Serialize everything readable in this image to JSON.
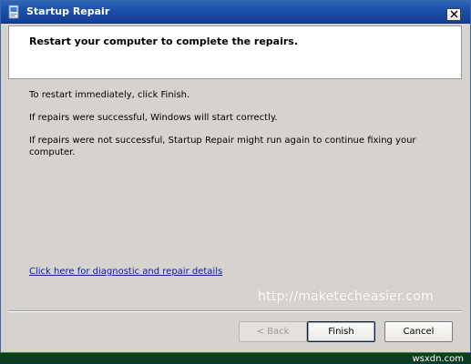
{
  "window": {
    "title": "Startup Repair",
    "icon": "computer-document-icon",
    "close_glyph": "✕"
  },
  "header": {
    "title": "Restart your computer to complete the repairs."
  },
  "body": {
    "line1": "To restart immediately, click Finish.",
    "line2": "If repairs were successful, Windows will start correctly.",
    "line3": "If repairs were not successful, Startup Repair might run again to continue fixing your computer."
  },
  "link": {
    "label": "Click here for diagnostic and repair details"
  },
  "watermark": "http://maketecheasier.com",
  "buttons": {
    "back": "< Back",
    "finish": "Finish",
    "cancel": "Cancel"
  },
  "credit": "wsxdn.com",
  "colors": {
    "titlebar": "#1a4fa8",
    "dialog_bg": "#d6d3ce",
    "link": "#0a1e8c",
    "desktop": "#0b4227"
  }
}
